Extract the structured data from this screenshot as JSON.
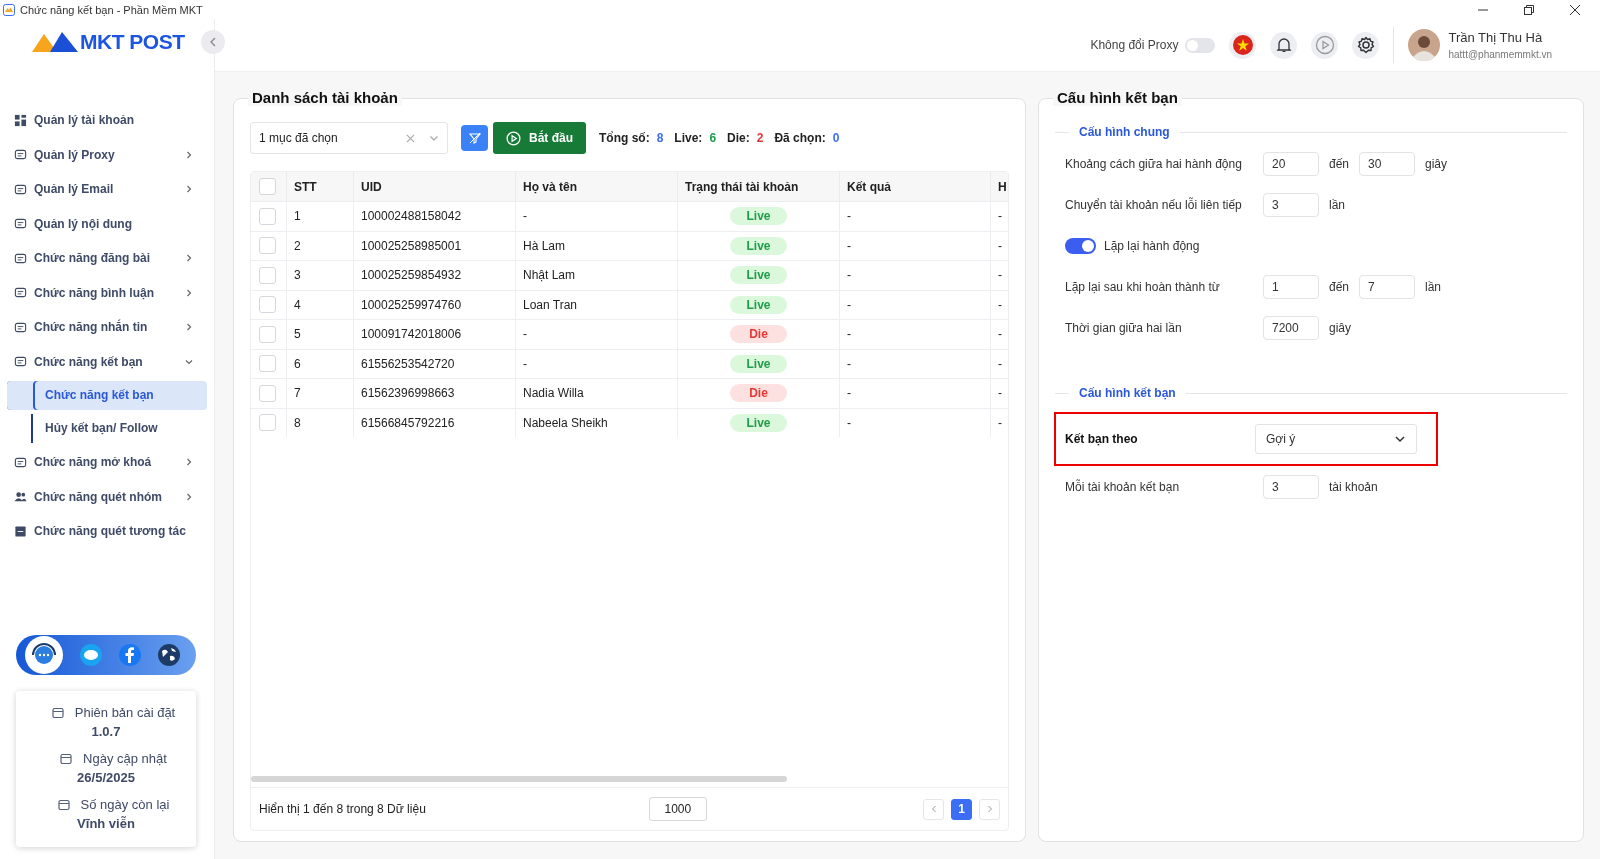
{
  "window": {
    "title": "Chức năng kết bạn - Phần Mềm MKT"
  },
  "sidebar": {
    "logo": "MKT POST",
    "items": [
      {
        "label": "Quản lý tài khoản",
        "kind": "link"
      },
      {
        "label": "Quản lý Proxy",
        "kind": "group",
        "expanded": false
      },
      {
        "label": "Quản lý Email",
        "kind": "group",
        "expanded": false
      },
      {
        "label": "Quản lý nội dung",
        "kind": "link"
      },
      {
        "label": "Chức năng đăng bài",
        "kind": "group",
        "expanded": false
      },
      {
        "label": "Chức năng bình luận",
        "kind": "group",
        "expanded": false
      },
      {
        "label": "Chức năng nhắn tin",
        "kind": "group",
        "expanded": false
      },
      {
        "label": "Chức năng kết bạn",
        "kind": "group",
        "expanded": true,
        "children": [
          {
            "label": "Chức năng kết bạn",
            "selected": true
          },
          {
            "label": "Hủy kết bạn/ Follow",
            "selected": false
          }
        ]
      },
      {
        "label": "Chức năng mở khoá",
        "kind": "group",
        "expanded": false
      },
      {
        "label": "Chức năng quét nhóm",
        "kind": "group",
        "expanded": false
      },
      {
        "label": "Chức năng quét tương tác",
        "kind": "link"
      }
    ],
    "info": [
      {
        "label": "Phiên bản cài đặt",
        "value": "1.0.7"
      },
      {
        "label": "Ngày cập nhật",
        "value": "26/5/2025"
      },
      {
        "label": "Số ngày còn lại",
        "value": "Vĩnh viễn"
      }
    ]
  },
  "header": {
    "proxy_label": "Không đổi Proxy",
    "proxy_toggle": {
      "on": false
    },
    "user": {
      "name": "Trần Thị Thu Hà",
      "email": "hattt@phanmemmkt.vn"
    }
  },
  "accounts": {
    "title": "Danh sách tài khoản",
    "select": {
      "value": "1 mục đã chọn"
    },
    "start_button": "Bắt đầu",
    "stats": [
      {
        "label": "Tổng số:",
        "value": "8",
        "color": "#3b6ef5"
      },
      {
        "label": "Live:",
        "value": "6",
        "color": "#1e9e4a"
      },
      {
        "label": "Die:",
        "value": "2",
        "color": "#e53935"
      },
      {
        "label": "Đã chọn:",
        "value": "0",
        "color": "#3b6ef5"
      }
    ],
    "table": {
      "select_all": {
        "checked": false
      },
      "columns": [
        "STT",
        "UID",
        "Họ và tên",
        "Trạng thái tài khoản",
        "Kết quả",
        "H"
      ],
      "rows": [
        {
          "checked": false,
          "stt": "1",
          "uid": "100002488158042",
          "name": "-",
          "status": {
            "text": "Live",
            "kind": "live"
          },
          "result": "-",
          "column_6": "-"
        },
        {
          "checked": false,
          "stt": "2",
          "uid": "100025258985001",
          "name": "Hà Lam",
          "status": {
            "text": "Live",
            "kind": "live"
          },
          "result": "-",
          "column_6": "-"
        },
        {
          "checked": false,
          "stt": "3",
          "uid": "100025259854932",
          "name": "Nhật Lam",
          "status": {
            "text": "Live",
            "kind": "live"
          },
          "result": "-",
          "column_6": "-"
        },
        {
          "checked": false,
          "stt": "4",
          "uid": "100025259974760",
          "name": "Loan Tran",
          "status": {
            "text": "Live",
            "kind": "live"
          },
          "result": "-",
          "column_6": "-"
        },
        {
          "checked": false,
          "stt": "5",
          "uid": "100091742018006",
          "name": "-",
          "status": {
            "text": "Die",
            "kind": "die"
          },
          "result": "-",
          "column_6": "-"
        },
        {
          "checked": false,
          "stt": "6",
          "uid": "61556253542720",
          "name": "-",
          "status": {
            "text": "Live",
            "kind": "live"
          },
          "result": "-",
          "column_6": "-"
        },
        {
          "checked": false,
          "stt": "7",
          "uid": "61562396998663",
          "name": "Nadia Willa",
          "status": {
            "text": "Die",
            "kind": "die"
          },
          "result": "-",
          "column_6": "-"
        },
        {
          "checked": false,
          "stt": "8",
          "uid": "61566845792216",
          "name": "Nabeela Sheikh",
          "status": {
            "text": "Live",
            "kind": "live"
          },
          "result": "-",
          "column_6": "-"
        }
      ]
    },
    "footer": {
      "summary": "Hiển thị 1 đến 8 trong 8 Dữ liệu",
      "page_size": "1000",
      "pages": [
        {
          "label": "1",
          "selected": true
        }
      ]
    }
  },
  "config": {
    "title": "Cấu hình kết bạn",
    "sections": [
      {
        "title": "Cấu hình chung",
        "rows": [
          {
            "kind": "range",
            "label": "Khoảng cách giữa hai hành động",
            "from": "20",
            "joiner": "đến",
            "to": "30",
            "unit": "giây"
          },
          {
            "kind": "single",
            "label": "Chuyển tài khoản nếu lỗi liên tiếp",
            "value": "3",
            "unit": "lần"
          },
          {
            "kind": "toggle",
            "label": "Lặp lại hành động",
            "on": true
          },
          {
            "kind": "range",
            "label": "Lặp lại sau khi hoàn thành từ",
            "from": "1",
            "joiner": "đến",
            "to": "7",
            "unit": "lần"
          },
          {
            "kind": "single",
            "label": "Thời gian giữa hai lần",
            "value": "7200",
            "unit": "giây"
          }
        ]
      },
      {
        "title": "Cấu hình kết bạn",
        "rows": [
          {
            "kind": "select",
            "label": "Kết bạn theo",
            "value": "Gợi ý",
            "highlighted": true
          },
          {
            "kind": "single",
            "label": "Mỗi tài khoản kết bạn",
            "value": "3",
            "unit": "tài khoản"
          }
        ]
      }
    ]
  }
}
